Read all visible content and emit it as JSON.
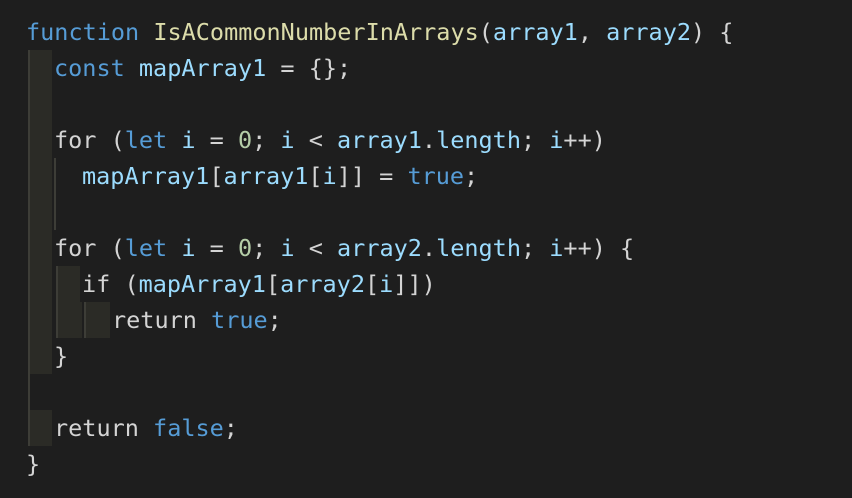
{
  "editor": {
    "lines": [
      [
        {
          "t": "function",
          "c": "kw"
        },
        {
          "t": " ",
          "c": "op"
        },
        {
          "t": "IsACommonNumberInArrays",
          "c": "fn"
        },
        {
          "t": "(",
          "c": "punc"
        },
        {
          "t": "array1",
          "c": "var"
        },
        {
          "t": ", ",
          "c": "punc"
        },
        {
          "t": "array2",
          "c": "var"
        },
        {
          "t": ") {",
          "c": "punc"
        }
      ],
      [
        {
          "t": "const",
          "c": "kw"
        },
        {
          "t": " ",
          "c": "op"
        },
        {
          "t": "mapArray1",
          "c": "var"
        },
        {
          "t": " = {};",
          "c": "op"
        }
      ],
      [],
      [
        {
          "t": "for",
          "c": "tok-for"
        },
        {
          "t": " (",
          "c": "punc"
        },
        {
          "t": "let",
          "c": "kw"
        },
        {
          "t": " ",
          "c": "op"
        },
        {
          "t": "i",
          "c": "var"
        },
        {
          "t": " = ",
          "c": "op"
        },
        {
          "t": "0",
          "c": "num"
        },
        {
          "t": "; ",
          "c": "punc"
        },
        {
          "t": "i",
          "c": "var"
        },
        {
          "t": " < ",
          "c": "op"
        },
        {
          "t": "array1",
          "c": "var"
        },
        {
          "t": ".",
          "c": "punc"
        },
        {
          "t": "length",
          "c": "var"
        },
        {
          "t": "; ",
          "c": "punc"
        },
        {
          "t": "i",
          "c": "var"
        },
        {
          "t": "++)",
          "c": "op"
        }
      ],
      [
        {
          "t": "mapArray1",
          "c": "var"
        },
        {
          "t": "[",
          "c": "punc"
        },
        {
          "t": "array1",
          "c": "var"
        },
        {
          "t": "[",
          "c": "punc"
        },
        {
          "t": "i",
          "c": "var"
        },
        {
          "t": "]] = ",
          "c": "punc"
        },
        {
          "t": "true",
          "c": "kw"
        },
        {
          "t": ";",
          "c": "punc"
        }
      ],
      [],
      [
        {
          "t": "for",
          "c": "tok-for"
        },
        {
          "t": " (",
          "c": "punc"
        },
        {
          "t": "let",
          "c": "kw"
        },
        {
          "t": " ",
          "c": "op"
        },
        {
          "t": "i",
          "c": "var"
        },
        {
          "t": " = ",
          "c": "op"
        },
        {
          "t": "0",
          "c": "num"
        },
        {
          "t": "; ",
          "c": "punc"
        },
        {
          "t": "i",
          "c": "var"
        },
        {
          "t": " < ",
          "c": "op"
        },
        {
          "t": "array2",
          "c": "var"
        },
        {
          "t": ".",
          "c": "punc"
        },
        {
          "t": "length",
          "c": "var"
        },
        {
          "t": "; ",
          "c": "punc"
        },
        {
          "t": "i",
          "c": "var"
        },
        {
          "t": "++) {",
          "c": "op"
        }
      ],
      [
        {
          "t": "if",
          "c": "tok-for"
        },
        {
          "t": " (",
          "c": "punc"
        },
        {
          "t": "mapArray1",
          "c": "var"
        },
        {
          "t": "[",
          "c": "punc"
        },
        {
          "t": "array2",
          "c": "var"
        },
        {
          "t": "[",
          "c": "punc"
        },
        {
          "t": "i",
          "c": "var"
        },
        {
          "t": "]])",
          "c": "punc"
        }
      ],
      [
        {
          "t": "return",
          "c": "tok-for"
        },
        {
          "t": " ",
          "c": "op"
        },
        {
          "t": "true",
          "c": "kw"
        },
        {
          "t": ";",
          "c": "punc"
        }
      ],
      [
        {
          "t": "}",
          "c": "brace"
        }
      ],
      [],
      [
        {
          "t": "return",
          "c": "tok-for"
        },
        {
          "t": " ",
          "c": "op"
        },
        {
          "t": "false",
          "c": "kw"
        },
        {
          "t": ";",
          "c": "punc"
        }
      ],
      [
        {
          "t": "}",
          "c": "brace"
        }
      ]
    ],
    "colors": {
      "background": "#1e1e1e",
      "keyword": "#569cd6",
      "function": "#dcdcaa",
      "variable": "#9cdcfe",
      "number": "#b5cea8",
      "text": "#d4d4d4"
    }
  }
}
